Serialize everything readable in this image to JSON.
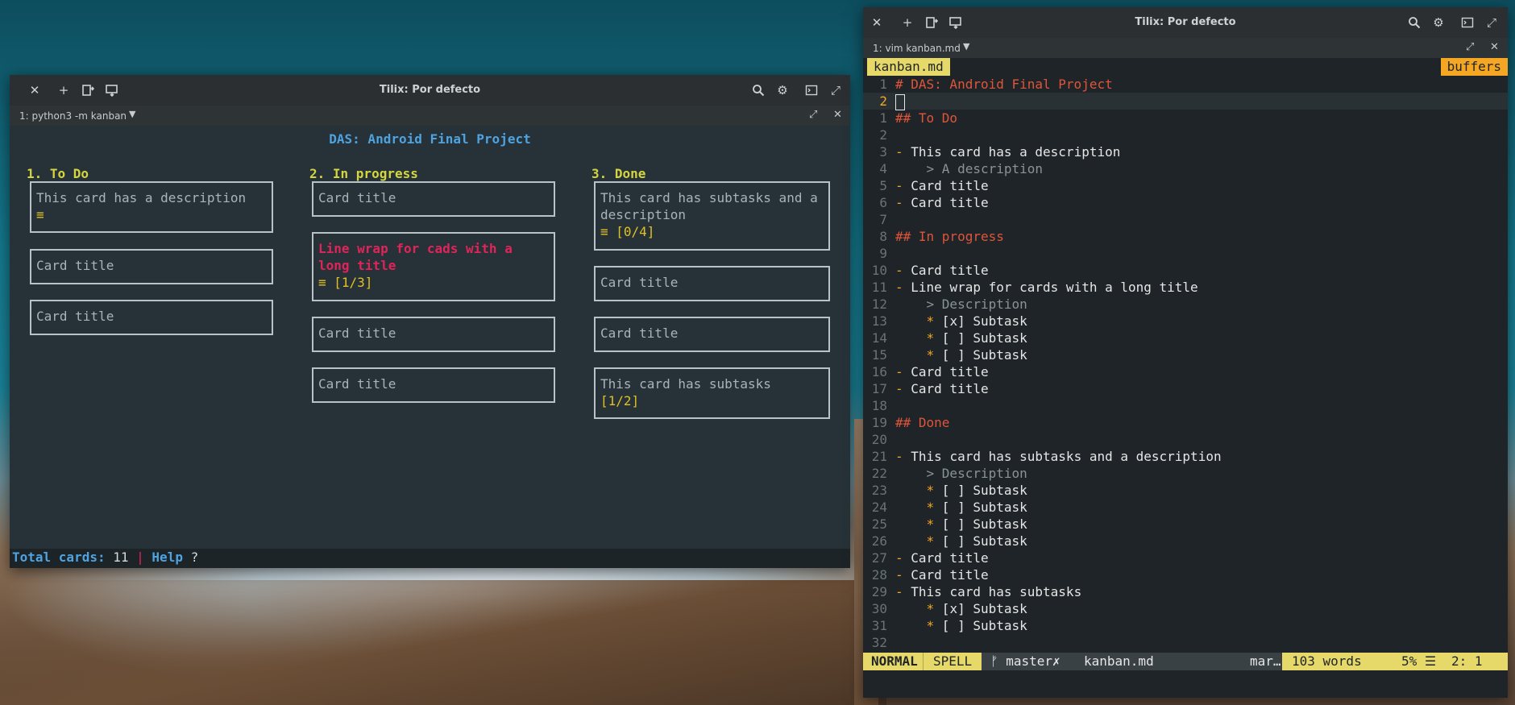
{
  "left_window": {
    "title": "Tilix: Por defecto",
    "tab_label": "1: python3 -m kanban",
    "board_title": "DAS: Android Final Project",
    "columns": [
      {
        "header": "1. To Do",
        "cards": [
          {
            "text": "This card has a description",
            "extra": "≡"
          },
          {
            "text": "Card title"
          },
          {
            "text": "Card title"
          }
        ]
      },
      {
        "header": "2. In progress",
        "cards": [
          {
            "text": "Card title"
          },
          {
            "text": "Line wrap for cads with a long title",
            "extra": "≡ [1/3]",
            "highlighted": true
          },
          {
            "text": "Card title"
          },
          {
            "text": "Card title"
          }
        ]
      },
      {
        "header": "3. Done",
        "cards": [
          {
            "text": "This card has subtasks and a description",
            "extra": "≡ [0/4]"
          },
          {
            "text": "Card title"
          },
          {
            "text": "Card title"
          },
          {
            "text": "This card has subtasks",
            "extra": "[1/2]"
          }
        ]
      }
    ],
    "status": {
      "total_label": "Total cards:",
      "total_value": "11",
      "separator": "|",
      "help_label": "Help",
      "help_key": "?"
    }
  },
  "right_window": {
    "title": "Tilix: Por defecto",
    "tab_label": "1: vim kanban.md",
    "vim_tab": "kanban.md",
    "buffers_label": "buffers",
    "lines": [
      {
        "n": "1",
        "t": "# DAS: Android Final Project"
      },
      {
        "n": "2",
        "t": ""
      },
      {
        "n": "1",
        "t": "## To Do"
      },
      {
        "n": "2",
        "t": ""
      },
      {
        "n": "3",
        "t": "- This card has a description"
      },
      {
        "n": "4",
        "t": "    > A description"
      },
      {
        "n": "5",
        "t": "- Card title"
      },
      {
        "n": "6",
        "t": "- Card title"
      },
      {
        "n": "7",
        "t": ""
      },
      {
        "n": "8",
        "t": "## In progress"
      },
      {
        "n": "9",
        "t": ""
      },
      {
        "n": "10",
        "t": "- Card title"
      },
      {
        "n": "11",
        "t": "- Line wrap for cards with a long title"
      },
      {
        "n": "12",
        "t": "    > Description"
      },
      {
        "n": "13",
        "t": "    * [x] Subtask"
      },
      {
        "n": "14",
        "t": "    * [ ] Subtask"
      },
      {
        "n": "15",
        "t": "    * [ ] Subtask"
      },
      {
        "n": "16",
        "t": "- Card title"
      },
      {
        "n": "17",
        "t": "- Card title"
      },
      {
        "n": "18",
        "t": ""
      },
      {
        "n": "19",
        "t": "## Done"
      },
      {
        "n": "20",
        "t": ""
      },
      {
        "n": "21",
        "t": "- This card has subtasks and a description"
      },
      {
        "n": "22",
        "t": "    > Description"
      },
      {
        "n": "23",
        "t": "    * [ ] Subtask"
      },
      {
        "n": "24",
        "t": "    * [ ] Subtask"
      },
      {
        "n": "25",
        "t": "    * [ ] Subtask"
      },
      {
        "n": "26",
        "t": "    * [ ] Subtask"
      },
      {
        "n": "27",
        "t": "- Card title"
      },
      {
        "n": "28",
        "t": "- Card title"
      },
      {
        "n": "29",
        "t": "- This card has subtasks"
      },
      {
        "n": "30",
        "t": "    * [x] Subtask"
      },
      {
        "n": "31",
        "t": "    * [ ] Subtask"
      },
      {
        "n": "32",
        "t": ""
      }
    ],
    "statusline": {
      "mode": "NORMAL",
      "spell": "SPELL",
      "branch": "ᚠ master✗",
      "file": "kanban.md",
      "filetype": "mar…",
      "words": "103 words",
      "percent": "5% ☰",
      "position": "2:  1"
    }
  }
}
